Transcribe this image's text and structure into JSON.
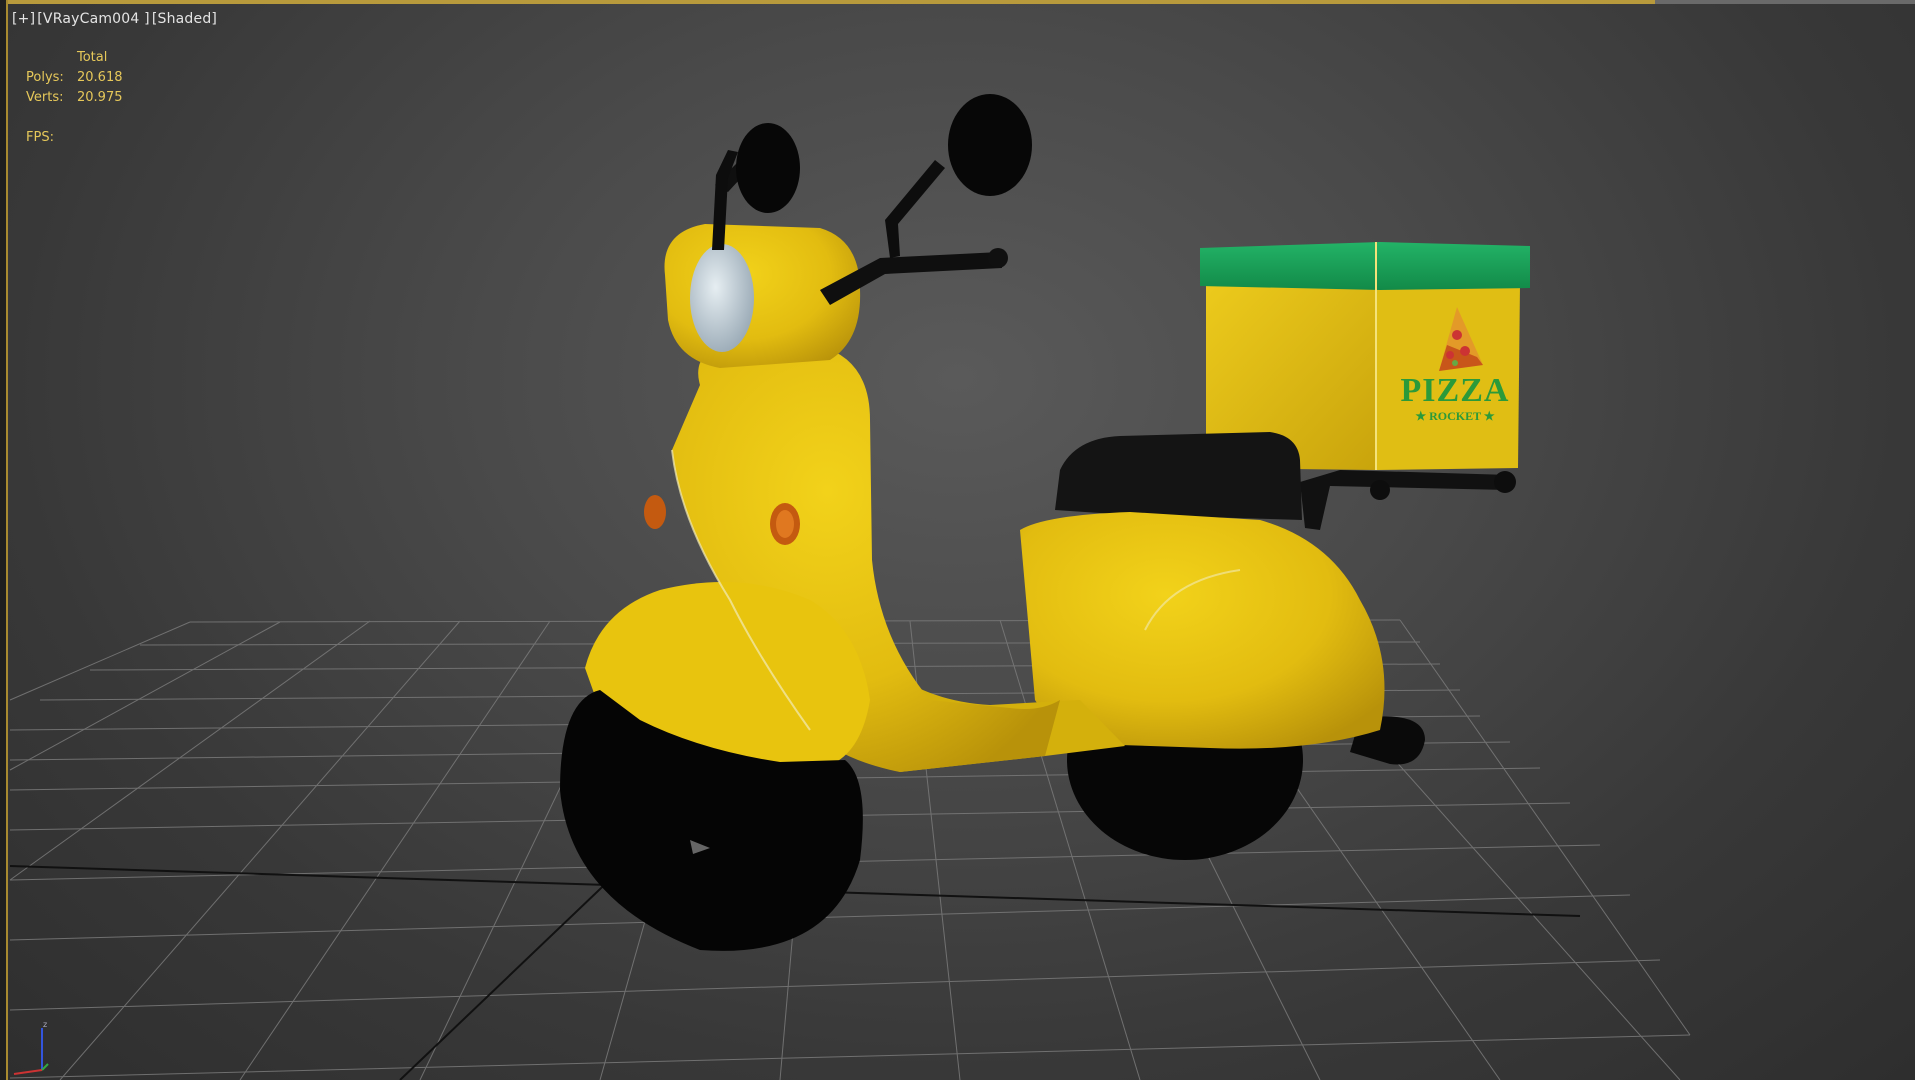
{
  "viewport": {
    "label_parts": [
      "[+]",
      "[VRayCam004 ]",
      "[Shaded]"
    ]
  },
  "stats": {
    "column_header": "Total",
    "polys_label": "Polys:",
    "polys_value": "20.618",
    "verts_label": "Verts:",
    "verts_value": "20.975",
    "fps_label": "FPS:"
  },
  "decal": {
    "brand": "PIZZA",
    "sub": "★ ROCKET ★"
  },
  "gizmo": {
    "z_label": "z"
  },
  "colors": {
    "body_yellow": "#e8c40e",
    "lid_green": "#1aa058",
    "logo_green": "#2b9a3a",
    "status_text": "#e6c85a"
  }
}
